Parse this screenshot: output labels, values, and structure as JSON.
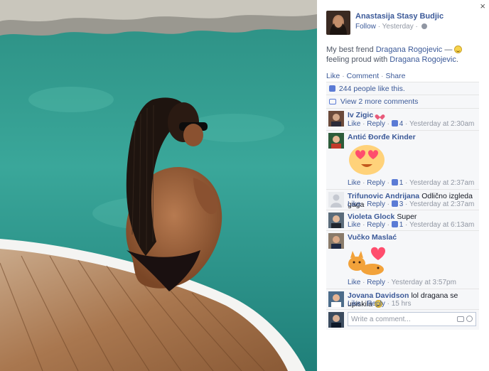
{
  "window": {
    "close_label": "×"
  },
  "post": {
    "author": "Anastasija Stasy Budjic",
    "follow_label": "Follow",
    "separator": "·",
    "time": "Yesterday",
    "separator2": "·",
    "caption_text": "My best frend",
    "caption_link1": "Dragana Rogojevic",
    "caption_dash": "—",
    "caption_feeling": "feeling proud with",
    "caption_link2": "Dragana Rogojevic",
    "caption_end": "."
  },
  "actions": {
    "like": "Like",
    "comment": "Comment",
    "share": "Share",
    "sep": "·"
  },
  "ufi": {
    "likes_text": "244 people like this.",
    "view_more": "View 2 more comments",
    "write_placeholder": "Write a comment..."
  },
  "comments": [
    {
      "name": "Iv Zigic",
      "text": "",
      "like": "Like",
      "reply": "Reply",
      "likes": "4",
      "time": "Yesterday at 2:30am"
    },
    {
      "name": "Antić Đorđe Kinder",
      "text": "",
      "like": "Like",
      "reply": "Reply",
      "likes": "1",
      "time": "Yesterday at 2:37am"
    },
    {
      "name": "Trifunovic Andrijana",
      "text": "Odlično izgleda gaga",
      "like": "Like",
      "reply": "Reply",
      "likes": "3",
      "time": "Yesterday at 2:37am"
    },
    {
      "name": "Violeta Glock",
      "text": "Super",
      "like": "Like",
      "reply": "Reply",
      "likes": "1",
      "time": "Yesterday at 6:13am"
    },
    {
      "name": "Vučko Maslać",
      "text": "",
      "like": "Like",
      "reply": "Reply",
      "likes": "",
      "time": "Yesterday at 3:57pm"
    },
    {
      "name": "Jovana Davidson",
      "text": "lol dragana se upiskila",
      "like": "Like",
      "reply": "Reply",
      "likes": "",
      "time": "15 hrs"
    }
  ],
  "colors": {
    "link": "#3b5998",
    "muted": "#9197a3",
    "panel_bg": "#f6f7f9"
  }
}
